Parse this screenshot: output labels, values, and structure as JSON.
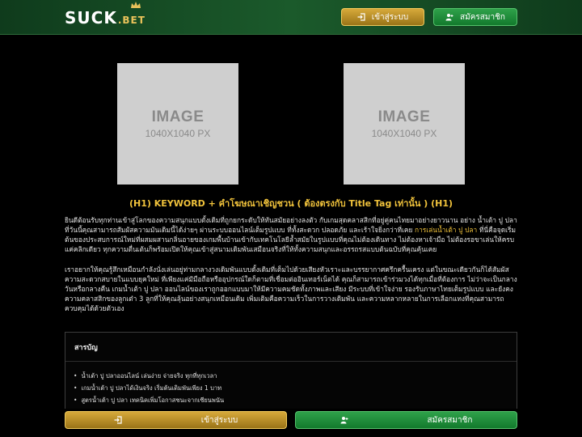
{
  "header": {
    "logo_main": "SUCK",
    "logo_sub": ".BET",
    "login_label": "เข้าสู่ระบบ",
    "register_label": "สมัครสมาชิก"
  },
  "images": [
    {
      "title": "IMAGE",
      "size": "1040X1040 PX"
    },
    {
      "title": "IMAGE",
      "size": "1040X1040 PX"
    }
  ],
  "heading": "(H1) KEYWORD + คำโฆษณาเชิญชวน ( ต้องตรงกับ Title Tag เท่านั้น ) (H1)",
  "paragraph1": {
    "before": "ยินดีต้อนรับทุกท่านเข้าสู่โลกของความสนุกแบบดั้งเดิมที่ถูกยกระดับให้ทันสมัยอย่างลงตัว กับเกมสุดคลาสสิกที่อยู่คู่คนไทยมาอย่างยาวนาน อย่าง น้ำเต้า ปู ปลา ที่วันนี้คุณสามารถสัมผัสความมันเดิมนี้ได้ง่ายๆ ผ่านระบบออนไลน์เต็มรูปแบบ ที่ทั้งสะดวก ปลอดภัย และเร้าใจยิ่งกว่าที่เคย ",
    "link": "การเล่นน้ำเต้า ปู ปลา",
    "after": " ที่นี่คือจุดเริ่มต้นของประสบการณ์ใหม่ที่ผสมผสานกลิ่นอายของเกมพื้นบ้านเข้ากับเทคโนโลยีล้ำสมัยในรูปแบบที่คุณไม่ต้องเดินทาง ไม่ต้องหาเจ้ามือ ไม่ต้องรอขาเล่นให้ครบ แค่คลิกเดียว ทุกความตื่นเต้นก็พร้อมเปิดให้คุณเข้าสู่สนามเดิมพันเสมือนจริงที่ให้ทั้งความสนุกและอรรถรสแบบต้นฉบับที่คุณคุ้นเคย"
  },
  "paragraph2": "เราอยากให้คุณรู้สึกเหมือนกำลังนั่งเล่นอยู่ท่ามกลางวงเดิมพันแบบดั้งเดิมที่เต็มไปด้วยเสียงหัวเราะและบรรยากาศครึกครื้นเครง แต่ในขณะเดียวกันก็ได้สัมผัสความสะดวกสบายในแบบยุคใหม่ ที่เพียงแค่มีมือถือหรืออุปกรณ์ใดก็ตามที่เชื่อมต่ออินเทอร์เน็ตได้ คุณก็สามารถเข้าร่วมวงได้ทุกเมื่อที่ต้องการ ไม่ว่าจะเป็นกลางวันหรือกลางคืน เกมน้ำเต้า ปู ปลา ออนไลน์ของเราถูกออกแบบมาให้มีความคมชัดทั้งภาพและเสียง มีระบบที่เข้าใจง่าย รองรับภาษาไทยเต็มรูปแบบ และยังคงความคลาสสิกของลูกเต๋า 3 ลูกที่ให้คุณลุ้นอย่างสนุกเหมือนเดิม เพิ่มเติมคือความเร็วในการวางเดิมพัน และความหลากหลายในการเลือกแทงที่คุณสามารถควบคุมได้ด้วยตัวเอง",
  "toc": {
    "title": "สารบัญ",
    "items": [
      "น้ำเต้า ปู ปลาออนไลน์ เล่นง่าย จ่ายจริง ทุกที่ทุกเวลา",
      "เกมน้ำเต้า ปู ปลาได้เงินจริง เริ่มต้นเดิมพันเพียง 1 บาท",
      "สูตรน้ำเต้า ปู ปลา เทคนิคเพิ่มโอกาสชนะจากเซียนพนัน"
    ]
  },
  "footer": {
    "login_label": "เข้าสู่ระบบ",
    "register_label": "สมัครสมาชิก"
  },
  "colors": {
    "accent_gold": "#f0c23b",
    "brand_green": "#1b5a2b",
    "register_green": "#2fa14a"
  }
}
